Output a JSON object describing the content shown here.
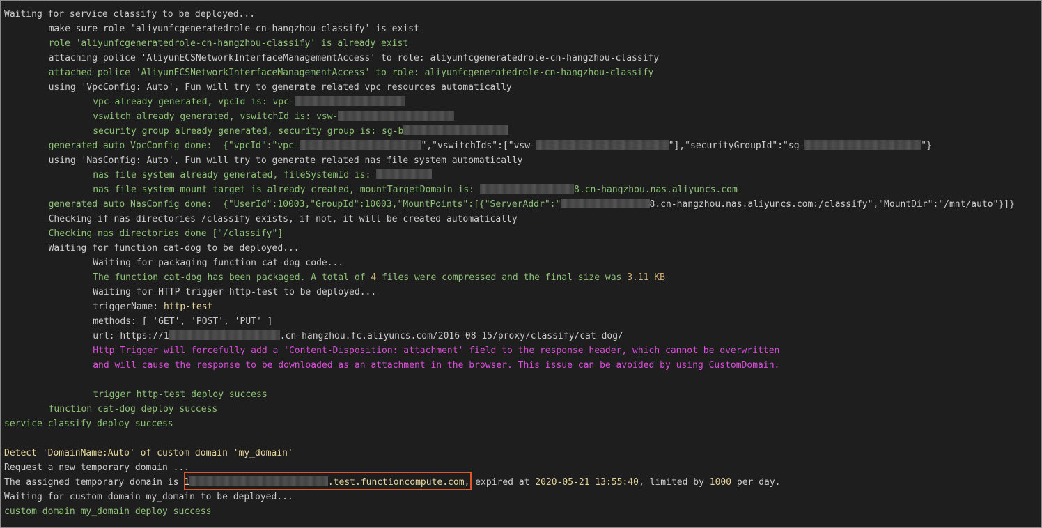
{
  "terminal": {
    "lines": [
      {
        "indent": 0,
        "segments": [
          {
            "t": "Waiting for service classify to be deployed...",
            "c": "w"
          }
        ]
      },
      {
        "indent": 8,
        "segments": [
          {
            "t": "make sure role 'aliyunfcgeneratedrole-cn-hangzhou-classify' is exist",
            "c": "w"
          }
        ]
      },
      {
        "indent": 8,
        "segments": [
          {
            "t": "role 'aliyunfcgeneratedrole-cn-hangzhou-classify' is already exist",
            "c": "g"
          }
        ]
      },
      {
        "indent": 8,
        "segments": [
          {
            "t": "attaching police 'AliyunECSNetworkInterfaceManagementAccess' to role: aliyunfcgeneratedrole-cn-hangzhou-classify",
            "c": "w"
          }
        ]
      },
      {
        "indent": 8,
        "segments": [
          {
            "t": "attached police 'AliyunECSNetworkInterfaceManagementAccess' to role: aliyunfcgeneratedrole-cn-hangzhou-classify",
            "c": "g"
          }
        ]
      },
      {
        "indent": 8,
        "segments": [
          {
            "t": "using 'VpcConfig: Auto', Fun will try to generate related vpc resources automatically",
            "c": "w"
          }
        ]
      },
      {
        "indent": 16,
        "segments": [
          {
            "t": "vpc already generated, vpcId is: vpc-",
            "c": "g"
          },
          {
            "redact": 20
          }
        ]
      },
      {
        "indent": 16,
        "segments": [
          {
            "t": "vswitch already generated, vswitchId is: vsw-",
            "c": "g"
          },
          {
            "redact": 21
          }
        ]
      },
      {
        "indent": 16,
        "segments": [
          {
            "t": "security group already generated, security group is: sg-b",
            "c": "g"
          },
          {
            "redact": 19
          }
        ]
      },
      {
        "indent": 8,
        "segments": [
          {
            "t": "generated auto VpcConfig done:  {\"vpcId\":\"vpc-",
            "c": "g"
          },
          {
            "redact": 22
          },
          {
            "t": "\",\"vswitchIds\":[\"vsw-",
            "c": "w"
          },
          {
            "redact": 24
          },
          {
            "t": "\"],\"securityGroupId\":\"sg-",
            "c": "w"
          },
          {
            "redact": 21
          },
          {
            "t": "\"}",
            "c": "w"
          }
        ]
      },
      {
        "indent": 8,
        "segments": [
          {
            "t": "using 'NasConfig: Auto', Fun will try to generate related nas file system automatically",
            "c": "w"
          }
        ]
      },
      {
        "indent": 16,
        "segments": [
          {
            "t": "nas file system already generated, fileSystemId is: ",
            "c": "g"
          },
          {
            "redact": 10
          }
        ]
      },
      {
        "indent": 16,
        "segments": [
          {
            "t": "nas file system mount target is already created, mountTargetDomain is: ",
            "c": "g"
          },
          {
            "redact": 17
          },
          {
            "t": "8.cn-hangzhou.nas.aliyuncs.com",
            "c": "g"
          }
        ]
      },
      {
        "indent": 8,
        "segments": [
          {
            "t": "generated auto NasConfig done:  {\"UserId\":10003,\"GroupId\":10003,\"MountPoints\":[{\"ServerAddr\":\"",
            "c": "g"
          },
          {
            "redact": 16
          },
          {
            "t": "8.cn-hangzhou.nas.aliyuncs.com:/classify\",\"MountDir\":\"/mnt/auto\"}]}",
            "c": "w"
          }
        ]
      },
      {
        "indent": 8,
        "segments": [
          {
            "t": "Checking if nas directories /classify exists, if not, it will be created automatically",
            "c": "w"
          }
        ]
      },
      {
        "indent": 8,
        "segments": [
          {
            "t": "Checking nas directories done [\"/classify\"]",
            "c": "g"
          }
        ]
      },
      {
        "indent": 8,
        "segments": [
          {
            "t": "Waiting for function cat-dog to be deployed...",
            "c": "w"
          }
        ]
      },
      {
        "indent": 16,
        "segments": [
          {
            "t": "Waiting for packaging function cat-dog code...",
            "c": "w"
          }
        ]
      },
      {
        "indent": 16,
        "segments": [
          {
            "t": "The function cat-dog has been packaged. A total of ",
            "c": "g"
          },
          {
            "t": "4",
            "c": "n"
          },
          {
            "t": " files were compressed and the final size was ",
            "c": "g"
          },
          {
            "t": "3.11 KB",
            "c": "n"
          }
        ]
      },
      {
        "indent": 16,
        "segments": [
          {
            "t": "Waiting for HTTP trigger http-test to be deployed...",
            "c": "w"
          }
        ]
      },
      {
        "indent": 16,
        "segments": [
          {
            "t": "triggerName: ",
            "c": "w"
          },
          {
            "t": "http-test",
            "c": "y"
          }
        ]
      },
      {
        "indent": 16,
        "segments": [
          {
            "t": "methods: [ 'GET', 'POST', 'PUT' ]",
            "c": "w"
          }
        ]
      },
      {
        "indent": 16,
        "segments": [
          {
            "t": "url: https://1",
            "c": "w"
          },
          {
            "redact": 20
          },
          {
            "t": ".cn-hangzhou.fc.aliyuncs.com/2016-08-15/proxy/classify/cat-dog/",
            "c": "w"
          }
        ]
      },
      {
        "indent": 16,
        "segments": [
          {
            "t": "Http Trigger will forcefully add a 'Content-Disposition: attachment' field to the response header, which cannot be overwritten",
            "c": "m"
          }
        ]
      },
      {
        "indent": 16,
        "segments": [
          {
            "t": "and will cause the response to be downloaded as an attachment in the browser. This issue can be avoided by using CustomDomain.",
            "c": "m"
          }
        ]
      },
      {
        "indent": 0,
        "segments": []
      },
      {
        "indent": 16,
        "segments": [
          {
            "t": "trigger http-test deploy success",
            "c": "g"
          }
        ]
      },
      {
        "indent": 8,
        "segments": [
          {
            "t": "function cat-dog deploy success",
            "c": "g"
          }
        ]
      },
      {
        "indent": 0,
        "segments": [
          {
            "t": "service classify deploy success",
            "c": "g"
          }
        ]
      },
      {
        "indent": 0,
        "segments": []
      },
      {
        "indent": 0,
        "segments": [
          {
            "t": "Detect 'DomainName:Auto' of custom domain 'my_domain'",
            "c": "y"
          }
        ]
      },
      {
        "indent": 0,
        "segments": [
          {
            "t": "Request a new temporary domain ...",
            "c": "w"
          }
        ]
      },
      {
        "indent": 0,
        "segments": [
          {
            "t": "The assigned temporary domain is ",
            "c": "w"
          },
          {
            "t": "1",
            "c": "y"
          },
          {
            "redact": 25
          },
          {
            "t": ".test.functioncompute.com",
            "c": "y"
          },
          {
            "t": ", expired at ",
            "c": "w"
          },
          {
            "t": "2020-05-21 13:55:40",
            "c": "y"
          },
          {
            "t": ", limited by ",
            "c": "w"
          },
          {
            "t": "1000",
            "c": "y"
          },
          {
            "t": " per day.",
            "c": "w"
          }
        ]
      },
      {
        "indent": 0,
        "segments": [
          {
            "t": "Waiting for custom domain my_domain to be deployed...",
            "c": "w"
          }
        ]
      },
      {
        "indent": 0,
        "segments": [
          {
            "t": "custom domain my_domain deploy success",
            "c": "g"
          }
        ]
      }
    ]
  }
}
